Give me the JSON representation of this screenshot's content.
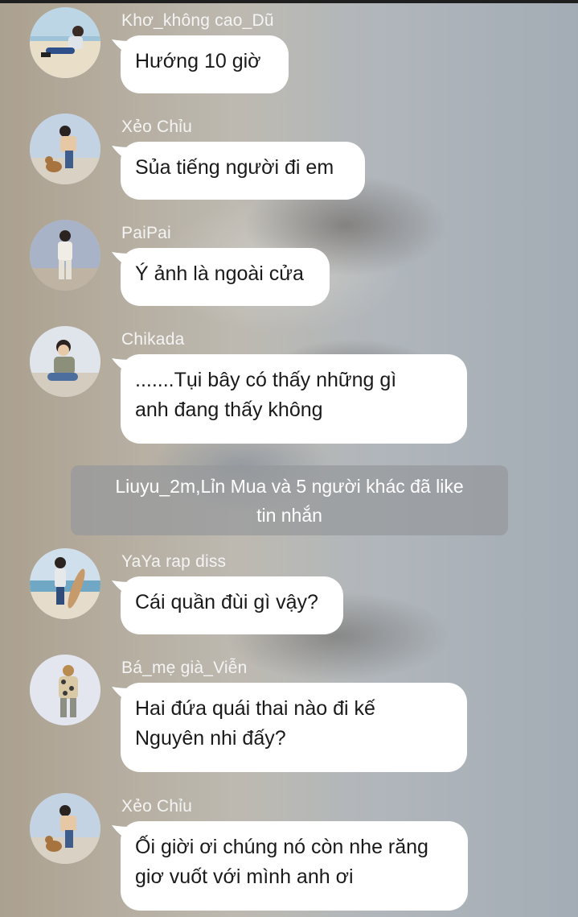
{
  "messages": [
    {
      "name": "Khơ_không cao_Dũ",
      "lines": [
        "Hướng 10 giờ"
      ],
      "avatar": "beach-sitting-avatar"
    },
    {
      "name": "Xẻo Chỉu",
      "lines": [
        "Sủa tiếng người đi em"
      ],
      "avatar": "dog-walker-avatar"
    },
    {
      "name": "PaiPai",
      "lines": [
        "Ý ảnh là ngoài cửa"
      ],
      "avatar": "standing-boy-avatar"
    },
    {
      "name": "Chikada",
      "lines": [
        ".......Tụi bây có thấy những gì",
        "anh đang thấy không"
      ],
      "avatar": "smiling-sitting-avatar"
    },
    {
      "name": "YaYa rap diss",
      "lines": [
        "Cái quần đùi gì vậy?"
      ],
      "avatar": "surfboard-avatar"
    },
    {
      "name": "Bá_mẹ già_Viễn",
      "lines": [
        "Hai đứa quái thai nào đi kế",
        "Nguyên nhi đấy?"
      ],
      "avatar": "floral-shirt-avatar"
    },
    {
      "name": "Xẻo Chỉu",
      "lines": [
        "Ối giời ơi chúng nó còn nhe răng",
        "giơ vuốt với mình anh ơi"
      ],
      "avatar": "dog-walker-avatar"
    }
  ],
  "reaction_notice": {
    "line1": "Liuyu_2m,Lỉn Mua và 5 người khác đã like",
    "line2": "tin nhắn"
  },
  "colors": {
    "bubble": "#ffffff",
    "name_text": "#f4f4f4",
    "notice_bg": "#96989b"
  }
}
